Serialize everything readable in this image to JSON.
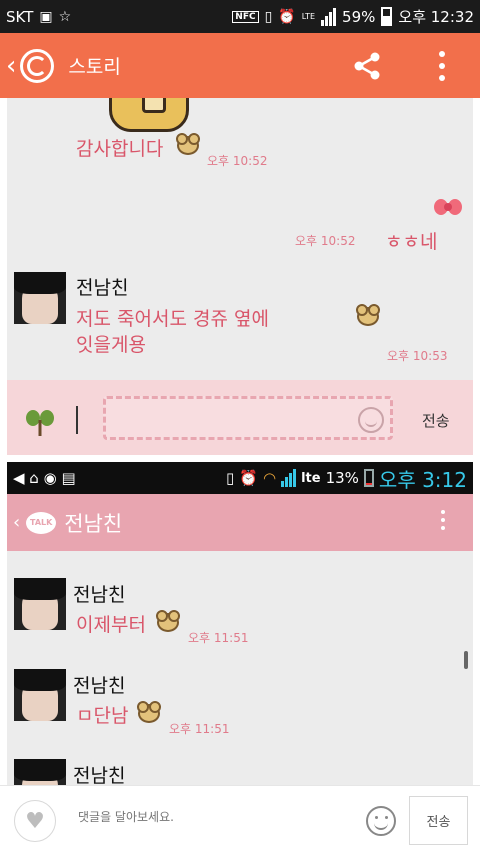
{
  "status_bar": {
    "carrier": "SKT",
    "nfc": "NFC",
    "lte": "LTE",
    "battery": "59%",
    "time": "오후 12:32"
  },
  "app_bar": {
    "title": "스토리"
  },
  "screenshot1": {
    "messages": [
      {
        "text": "감사합니다",
        "time": "오후 10:52"
      },
      {
        "text": "ㅎㅎ네",
        "time": "오후 10:52"
      },
      {
        "sender": "전남친",
        "text_line1": "저도 죽어서도 경쥬 옆에",
        "text_line2": "잇을게용",
        "time": "오후 10:53"
      }
    ],
    "send_label": "전송"
  },
  "screenshot2": {
    "status_bar": {
      "battery": "13%",
      "time": "오후 3:12",
      "lte": "lte"
    },
    "talk_icon": "TALK",
    "chat_title": "전남친",
    "messages": [
      {
        "sender": "전남친",
        "text": "이제부터",
        "time": "오후 11:51"
      },
      {
        "sender": "전남친",
        "text": "ㅁ단남",
        "time": "오후 11:51"
      },
      {
        "sender": "전남친"
      }
    ]
  },
  "bottom_bar": {
    "comment_placeholder": "댓글을 달아보세요.",
    "send_label": "전송"
  },
  "colors": {
    "app_bar": "#f26f4b",
    "chat_text": "#d9566a",
    "kakao_bar": "#e8a5b0",
    "input_bar": "#f6d6d9"
  },
  "icons": [
    "back-icon",
    "story-logo-icon",
    "share-icon",
    "more-icon",
    "bear-emoticon-icon",
    "ribbon-icon",
    "sprout-icon",
    "smile-icon",
    "heart-icon",
    "emoji-icon",
    "talk-icon"
  ]
}
